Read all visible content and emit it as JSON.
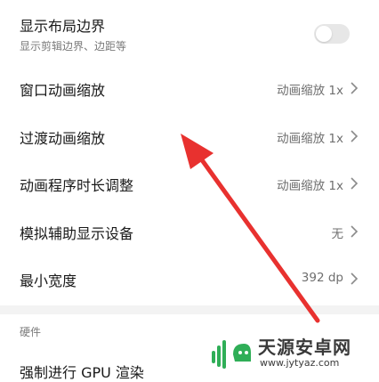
{
  "settings": [
    {
      "title": "显示布局边界",
      "subtitle": "显示剪辑边界、边距等",
      "control": "toggle",
      "toggle_on": false
    },
    {
      "title": "窗口动画缩放",
      "value": "动画缩放 1x"
    },
    {
      "title": "过渡动画缩放",
      "value": "动画缩放 1x"
    },
    {
      "title": "动画程序时长调整",
      "value": "动画缩放 1x"
    },
    {
      "title": "模拟辅助显示设备",
      "value": "无"
    },
    {
      "title": "最小宽度",
      "value": "392 dp"
    }
  ],
  "section": {
    "label": "硬件"
  },
  "hardware_items": [
    {
      "title": "强制进行 GPU 渲染"
    }
  ],
  "annotation": {
    "color": "#e8312f"
  },
  "watermark": {
    "text": "天源安卓网",
    "url": "www.jytyaz.com",
    "logo_color": "#2fae57"
  },
  "icons": {
    "chevron": "chevron-right-icon"
  }
}
